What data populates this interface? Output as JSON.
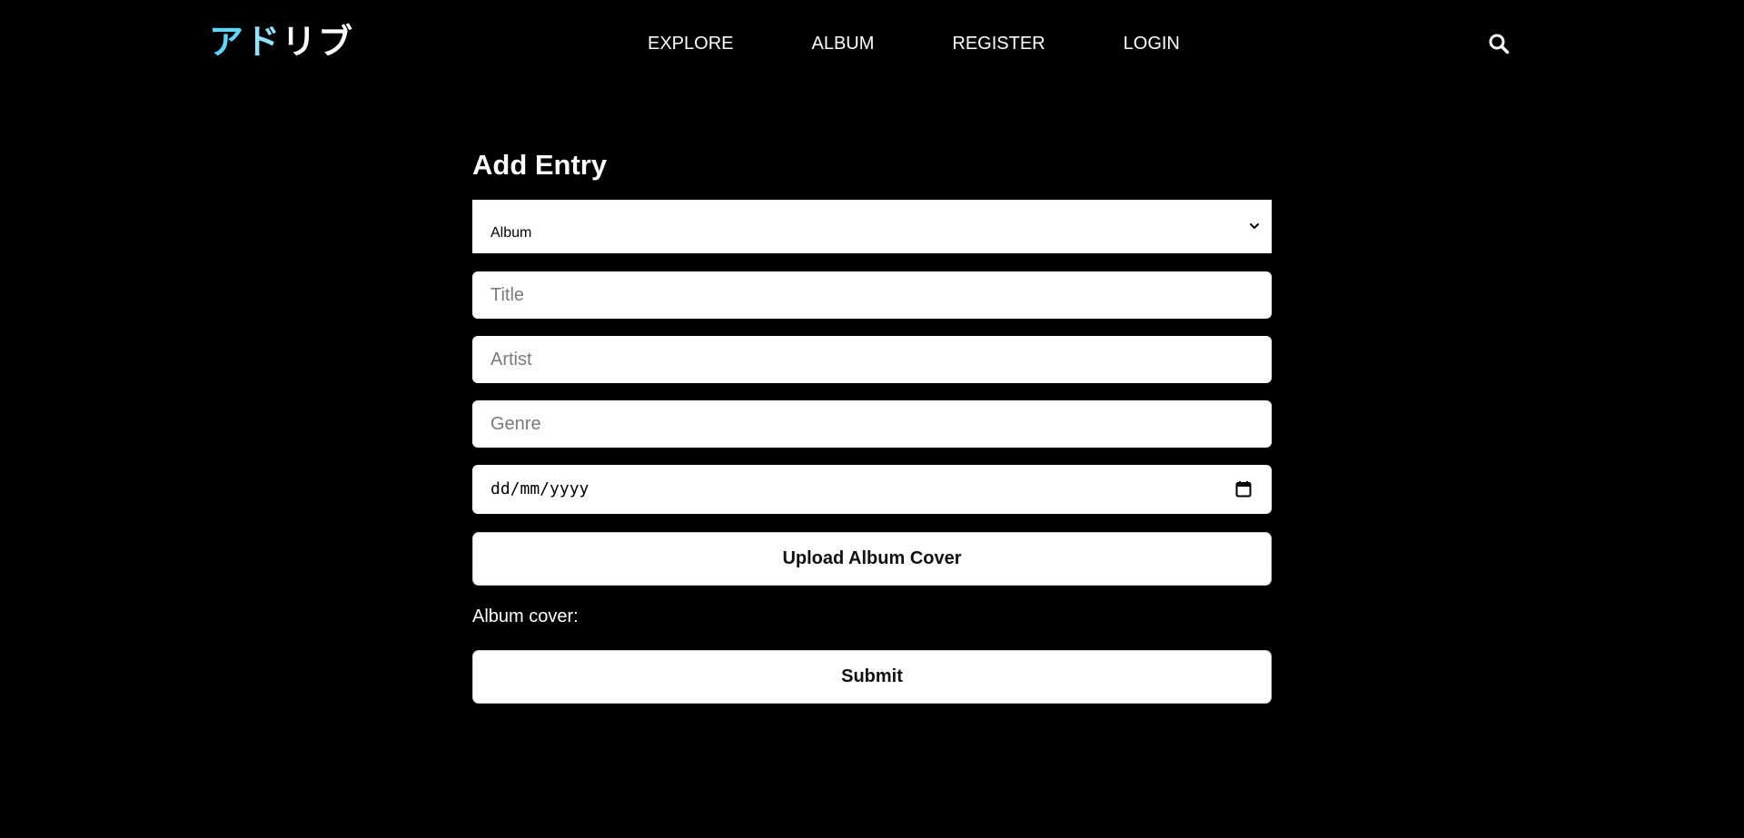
{
  "nav": {
    "logo": [
      "ア",
      "ド",
      "リブ"
    ],
    "links": [
      "EXPLORE",
      "ALBUM",
      "REGISTER",
      "LOGIN"
    ],
    "search_icon": "search-icon"
  },
  "form": {
    "title": "Add Entry",
    "type_select": {
      "value": "Album",
      "icon": "chevron-down-icon"
    },
    "title_input": {
      "placeholder": "Title",
      "value": ""
    },
    "artist_input": {
      "placeholder": "Artist",
      "value": ""
    },
    "genre_input": {
      "placeholder": "Genre",
      "value": ""
    },
    "date_input": {
      "value": "dd/mm/yyyy",
      "icon": "calendar-icon"
    },
    "upload_label": "Upload Album Cover",
    "cover_label": "Album cover:",
    "submit_label": "Submit"
  },
  "colors": {
    "background": "#000000",
    "logo_accent": "#5fd6ff",
    "text": "#ffffff",
    "field_bg": "#ffffff"
  }
}
